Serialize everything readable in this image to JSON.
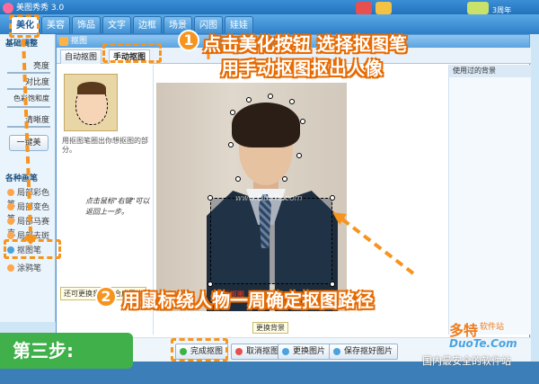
{
  "app": {
    "title": "美图秀秀 3.0",
    "birthday": "3周年"
  },
  "main_tabs": [
    "美化",
    "美容",
    "饰品",
    "文字",
    "边框",
    "场景",
    "闪图",
    "娃娃"
  ],
  "left_panel": {
    "title": "基础调整",
    "adjustments": [
      "亮度",
      "对比度",
      "色彩饱和度",
      "清晰度"
    ],
    "one_click_button": "一键美",
    "pens_title": "各种画笔",
    "pens": [
      "局部彩色笔",
      "局部变色笔",
      "局部马赛克",
      "局部去斑",
      "抠图笔",
      "涂鸦笔"
    ]
  },
  "dialog": {
    "title": "抠图",
    "tabs": [
      "自动抠图",
      "手动抠图"
    ],
    "right_header": "使用过的背景",
    "side_text": "用抠图笔圈出你想抠图的部分。",
    "hand_note": "点击鼠标\"右键\"可以返回上一步。",
    "redo_label": "重新抠图",
    "photo_watermark": "www.DuoTe.com",
    "tooltip_left": "还可更换背景、合成图片",
    "buttons": {
      "complete": "完成抠图",
      "cancel": "取消抠图",
      "change": "更换图片",
      "save": "保存抠好图片"
    },
    "tip_small": "更换背景"
  },
  "callouts": {
    "step1_line1": "点击美化按钮 选择抠图笔",
    "step1_line2": "用手动抠图抠出人像",
    "step1_num": "1",
    "step2_text": "用鼠标绕人物一周确定抠图路径",
    "step2_num": "2"
  },
  "step_badge": "第三步:",
  "brand": {
    "name": "多特",
    "sub": "软件站",
    "url": "DuoTe.Com",
    "footer": "国内最安全的软件站"
  },
  "colors": {
    "accent_orange": "#f7941d",
    "step_green": "#3fb04a",
    "app_blue": "#2c7fc8"
  }
}
